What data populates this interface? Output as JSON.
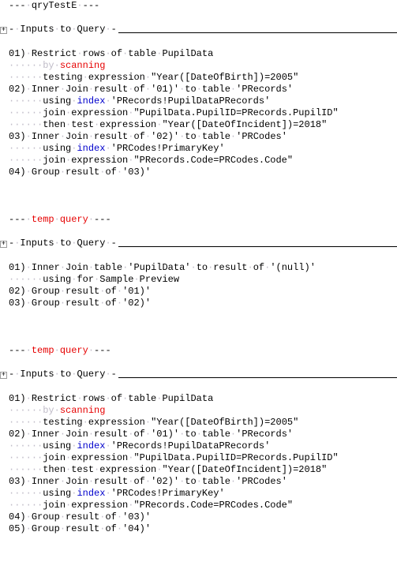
{
  "sections": [
    {
      "header": {
        "prefix": "---·",
        "name": "qryTestE",
        "suffix": "·---",
        "name_style": "normal"
      },
      "expander": "+",
      "inputs_label": "-·Inputs·to·Query·-",
      "lines": [
        [
          {
            "t": "01)·Restrict·rows·of·table·"
          },
          {
            "t": "PupilData"
          }
        ],
        [
          {
            "t": "······by·",
            "cls": "dot"
          },
          {
            "t": "scanning",
            "cls": "kw-scan"
          }
        ],
        [
          {
            "t": "······",
            "cls": "dot"
          },
          {
            "t": "testing·expression·\"Year([DateOfBirth])=2005\""
          }
        ],
        [
          {
            "t": "02)·Inner·Join·result·of·'01)'·to·table·'PRecords'"
          }
        ],
        [
          {
            "t": "······",
            "cls": "dot"
          },
          {
            "t": "using·"
          },
          {
            "t": "index",
            "cls": "kw-idx"
          },
          {
            "t": "·'PRecords!PupilDataPRecords'"
          }
        ],
        [
          {
            "t": "······",
            "cls": "dot"
          },
          {
            "t": "join·expression·\"PupilData.PupilID=PRecords.PupilID\""
          }
        ],
        [
          {
            "t": "······",
            "cls": "dot"
          },
          {
            "t": "then·test·expression·\"Year([DateOfIncident])=2018\""
          }
        ],
        [
          {
            "t": "03)·Inner·Join·result·of·'02)'·to·table·'PRCodes'"
          }
        ],
        [
          {
            "t": "······",
            "cls": "dot"
          },
          {
            "t": "using·"
          },
          {
            "t": "index",
            "cls": "kw-idx"
          },
          {
            "t": "·'PRCodes!PrimaryKey'"
          }
        ],
        [
          {
            "t": "······",
            "cls": "dot"
          },
          {
            "t": "join·expression·\"PRecords.Code=PRCodes.Code\""
          }
        ],
        [
          {
            "t": "04)·Group·result·of·'03)'"
          }
        ]
      ]
    },
    {
      "header": {
        "prefix": "---·",
        "name": "temp·query",
        "suffix": "·---",
        "name_style": "kw-temp"
      },
      "expander": "+",
      "inputs_label": "-·Inputs·to·Query·-",
      "lines": [
        [
          {
            "t": "01)·Inner·Join·table·'PupilData'·to·result·of·'(null)'"
          }
        ],
        [
          {
            "t": "······",
            "cls": "dot"
          },
          {
            "t": "using·for·Sample·Preview"
          }
        ],
        [
          {
            "t": "02)·Group·result·of·'01)'"
          }
        ],
        [
          {
            "t": "03)·Group·result·of·'02)'"
          }
        ]
      ]
    },
    {
      "header": {
        "prefix": "---·",
        "name": "temp·query",
        "suffix": "·---",
        "name_style": "kw-temp"
      },
      "expander": "+",
      "inputs_label": "-·Inputs·to·Query·-",
      "lines": [
        [
          {
            "t": "01)·Restrict·rows·of·table·"
          },
          {
            "t": "PupilData"
          }
        ],
        [
          {
            "t": "······by·",
            "cls": "dot"
          },
          {
            "t": "scanning",
            "cls": "kw-scan"
          }
        ],
        [
          {
            "t": "······",
            "cls": "dot"
          },
          {
            "t": "testing·expression·\"Year([DateOfBirth])=2005\""
          }
        ],
        [
          {
            "t": "02)·Inner·Join·result·of·'01)'·to·table·'PRecords'"
          }
        ],
        [
          {
            "t": "······",
            "cls": "dot"
          },
          {
            "t": "using·"
          },
          {
            "t": "index",
            "cls": "kw-idx"
          },
          {
            "t": "·'PRecords!PupilDataPRecords'"
          }
        ],
        [
          {
            "t": "······",
            "cls": "dot"
          },
          {
            "t": "join·expression·\"PupilData.PupilID=PRecords.PupilID\""
          }
        ],
        [
          {
            "t": "······",
            "cls": "dot"
          },
          {
            "t": "then·test·expression·\"Year([DateOfIncident])=2018\""
          }
        ],
        [
          {
            "t": "03)·Inner·Join·result·of·'02)'·to·table·'PRCodes'"
          }
        ],
        [
          {
            "t": "······",
            "cls": "dot"
          },
          {
            "t": "using·"
          },
          {
            "t": "index",
            "cls": "kw-idx"
          },
          {
            "t": "·'PRCodes!PrimaryKey'"
          }
        ],
        [
          {
            "t": "······",
            "cls": "dot"
          },
          {
            "t": "join·expression·\"PRecords.Code=PRCodes.Code\""
          }
        ],
        [
          {
            "t": "04)·Group·result·of·'03)'"
          }
        ],
        [
          {
            "t": "05)·Group·result·of·'04)'"
          }
        ]
      ]
    }
  ]
}
